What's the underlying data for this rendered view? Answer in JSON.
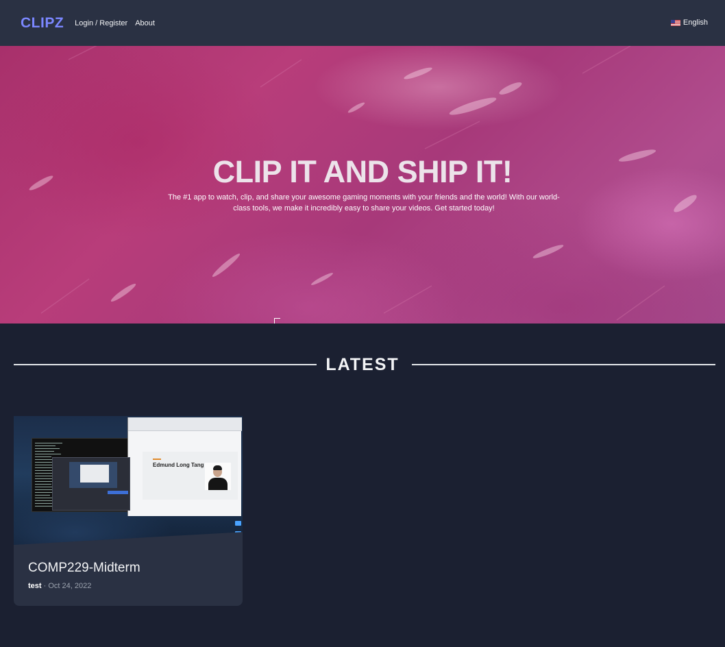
{
  "nav": {
    "logo": "CLIPZ",
    "login_register": "Login / Register",
    "about": "About",
    "language": "English",
    "language_flag_icon": "us-flag-icon"
  },
  "hero": {
    "title": "CLIP IT AND SHIP IT!",
    "description": "The #1 app to watch, clip, and share your awesome gaming moments with your friends and the world! With our world-class tools, we make it incredibly easy to share your videos. Get started today!"
  },
  "latest": {
    "heading": "LATEST",
    "clips": [
      {
        "title": "COMP229-Midterm",
        "user": "test",
        "separator": "·",
        "date": "Oct 24, 2022",
        "thumbnail_slide_name": "Edmund Long Tang"
      }
    ]
  },
  "colors": {
    "navbar_bg": "#2a3143",
    "page_bg": "#1b2031",
    "logo": "#7b87ff",
    "hero_tint": "#b03a78",
    "card_bg": "#2a3143"
  }
}
